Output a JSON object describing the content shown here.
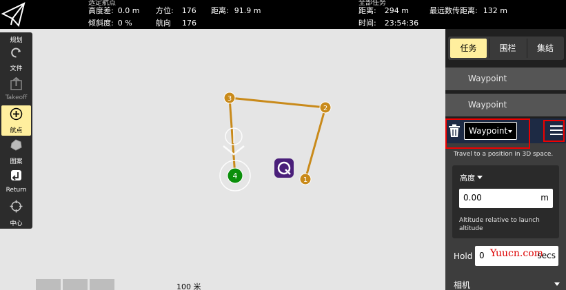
{
  "top_bar": {
    "partial_left": "选定航点",
    "partial_right": "全部任务",
    "altitude_diff_label": "高度差:",
    "altitude_diff_value": "0.0 m",
    "bearing_label": "方位:",
    "bearing_value": "176",
    "distance_label": "距离:",
    "distance_value": "91.9 m",
    "gradient_label": "倾斜度:",
    "gradient_value": "0 %",
    "heading_label": "航向",
    "heading_value": "176",
    "total_distance_label": "距离:",
    "total_distance_value": "294 m",
    "max_telem_label": "最远数传距离:",
    "max_telem_value": "132 m",
    "time_label": "时间:",
    "time_value": "23:54:36"
  },
  "toolbar": {
    "title": "规划",
    "items": [
      {
        "label": "文件",
        "icon": "file-sync-icon"
      },
      {
        "label": "Takeoff",
        "icon": "takeoff-icon"
      },
      {
        "label": "航点",
        "icon": "add-waypoint-icon"
      },
      {
        "label": "图案",
        "icon": "pattern-icon"
      },
      {
        "label": "Return",
        "icon": "return-icon"
      },
      {
        "label": "中心",
        "icon": "center-icon"
      }
    ]
  },
  "map": {
    "scale_label": "100 米",
    "waypoints": [
      {
        "label": "1",
        "color": "#c98a1a"
      },
      {
        "label": "2",
        "color": "#c98a1a"
      },
      {
        "label": "3",
        "color": "#c98a1a"
      },
      {
        "label": "4",
        "color": "#0b8f0b"
      }
    ],
    "path_color": "#c98a1a",
    "vehicle_icon": "drone-logo-icon"
  },
  "panel": {
    "tabs": [
      {
        "label": "任务",
        "active": true
      },
      {
        "label": "围栏",
        "active": false
      },
      {
        "label": "集结",
        "active": false
      }
    ],
    "mission_items": [
      {
        "label": "Waypoint"
      },
      {
        "label": "Waypoint"
      }
    ],
    "editor": {
      "command": "Waypoint",
      "description": "Travel to a position in 3D space.",
      "altitude_mode": "高度",
      "altitude_value": "0.00",
      "altitude_unit": "m",
      "altitude_help": "Altitude relative to launch altitude",
      "hold_label": "Hold",
      "hold_value": "0",
      "hold_unit": "secs",
      "watermark": "Yuucn.com",
      "camera_label": "相机"
    }
  },
  "colors": {
    "active_yellow": "#ffef9e",
    "highlight_red": "#e00000",
    "editor_header": "#1d2a44"
  }
}
